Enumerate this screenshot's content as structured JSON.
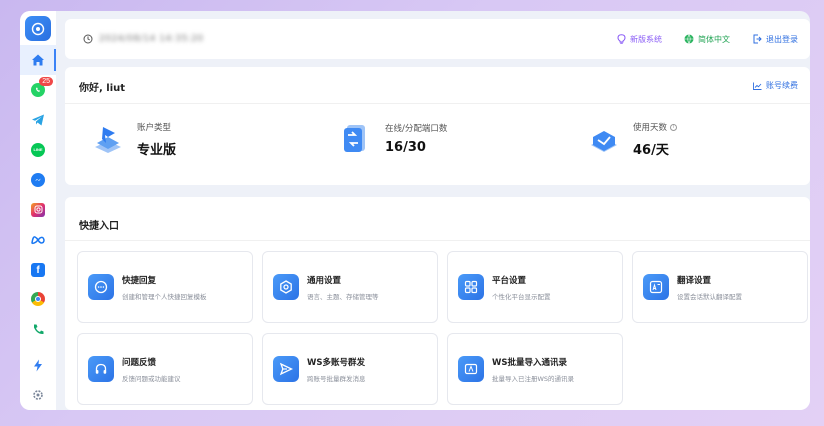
{
  "topbar": {
    "time_text": "2024/08/14 14:35:20",
    "links": [
      {
        "label": "新版系统",
        "icon": "bulb-icon"
      },
      {
        "label": "简体中文",
        "icon": "globe-icon"
      },
      {
        "label": "退出登录",
        "icon": "logout-icon"
      }
    ]
  },
  "sidebar": {
    "badge_count": "25",
    "items": [
      {
        "name": "home",
        "icon": "home-icon"
      },
      {
        "name": "whatsapp",
        "icon": "whatsapp-icon"
      },
      {
        "name": "telegram",
        "icon": "telegram-icon"
      },
      {
        "name": "line",
        "icon": "line-icon"
      },
      {
        "name": "messenger",
        "icon": "messenger-icon"
      },
      {
        "name": "instagram",
        "icon": "instagram-icon"
      },
      {
        "name": "meta",
        "icon": "meta-icon"
      },
      {
        "name": "facebook",
        "icon": "facebook-icon"
      },
      {
        "name": "chrome",
        "icon": "chrome-icon"
      },
      {
        "name": "phone",
        "icon": "phone-icon"
      },
      {
        "name": "quick",
        "icon": "lightning-icon"
      },
      {
        "name": "settings",
        "icon": "gear-icon"
      }
    ]
  },
  "welcome": {
    "greeting": "你好, liut",
    "link_label": "账号续费",
    "stats": [
      {
        "label": "账户类型",
        "value": "专业版"
      },
      {
        "label": "在线/分配端口数",
        "value": "16/30"
      },
      {
        "label": "使用天数",
        "value": "46/天"
      }
    ]
  },
  "quick": {
    "title": "快捷入口",
    "cards": [
      {
        "title": "快捷回复",
        "desc": "创建和管理个人快捷回复模板",
        "icon": "chat-bubble-icon"
      },
      {
        "title": "通用设置",
        "desc": "语言、主题、存储管理等",
        "icon": "settings-hex-icon"
      },
      {
        "title": "平台设置",
        "desc": "个性化平台显示配置",
        "icon": "grid-icon"
      },
      {
        "title": "翻译设置",
        "desc": "设置会话默认翻译配置",
        "icon": "translate-icon"
      },
      {
        "title": "问题反馈",
        "desc": "反馈问题或功能建议",
        "icon": "headphones-icon"
      },
      {
        "title": "WS多账号群发",
        "desc": "跨账号批量群发消息",
        "icon": "send-icon"
      },
      {
        "title": "WS批量导入通讯录",
        "desc": "批量导入已注册WS的通讯录",
        "icon": "contacts-icon"
      }
    ]
  },
  "colors": {
    "accent": "#2f6fe0",
    "badge": "#f04848"
  }
}
